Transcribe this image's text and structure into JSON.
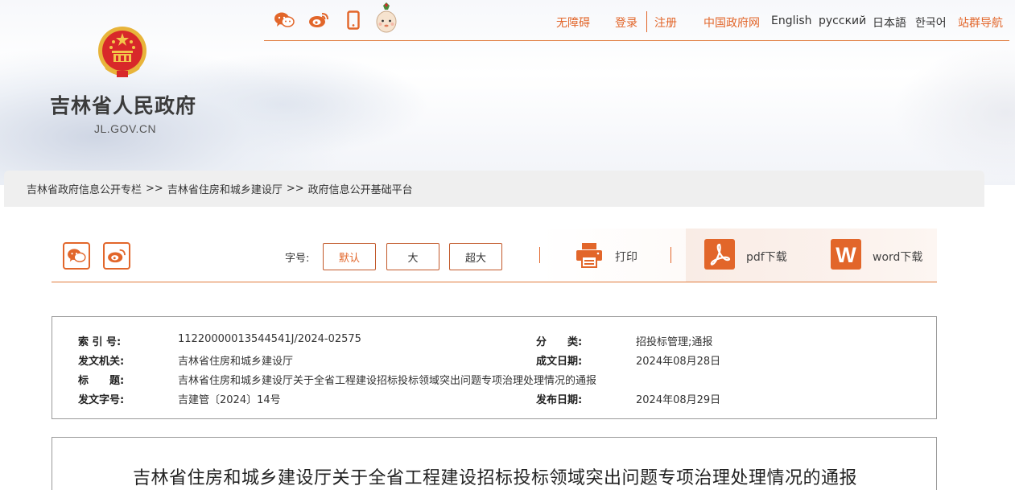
{
  "header": {
    "site_name": "吉林省人民政府",
    "site_domain": "JL.GOV.CN",
    "social_icons": [
      "wechat-icon",
      "weibo-icon",
      "mobile-icon",
      "mascot-icon"
    ],
    "links": {
      "accessibility": "无障碍",
      "login": "登录",
      "register": "注册",
      "gov_portal": "中国政府网",
      "english": "English",
      "russian": "русский",
      "japanese": "日本語",
      "korean": "한국어",
      "site_nav": "站群导航"
    },
    "accent_color": "#e2662a"
  },
  "breadcrumb": {
    "items": [
      "吉林省政府信息公开专栏",
      "吉林省住房和城乡建设厅",
      "政府信息公开基础平台"
    ],
    "separator": ">>"
  },
  "toolbar": {
    "font_label": "字号:",
    "font_sizes": [
      "默认",
      "大",
      "超大"
    ],
    "active_font_size": "默认",
    "print": "打印",
    "pdf": "pdf下载",
    "word": "word下载",
    "word_icon_letter": "W"
  },
  "info": {
    "index_label": "索 引 号:",
    "index_value": "11220000013544541J/2024-02575",
    "category_label": "分　　类:",
    "category_value": "招投标管理;通报",
    "issuer_label": "发文机关:",
    "issuer_value": "吉林省住房和城乡建设厅",
    "written_label": "成文日期:",
    "written_value": "2024年08月28日",
    "title_label": "标　　题:",
    "title_value": "吉林省住房和城乡建设厅关于全省工程建设招标投标领域突出问题专项治理处理情况的通报",
    "docno_label": "发文字号:",
    "docno_value": "吉建管〔2024〕14号",
    "published_label": "发布日期:",
    "published_value": "2024年08月29日"
  },
  "article": {
    "title": "吉林省住房和城乡建设厅关于全省工程建设招标投标领域突出问题专项治理处理情况的通报"
  }
}
